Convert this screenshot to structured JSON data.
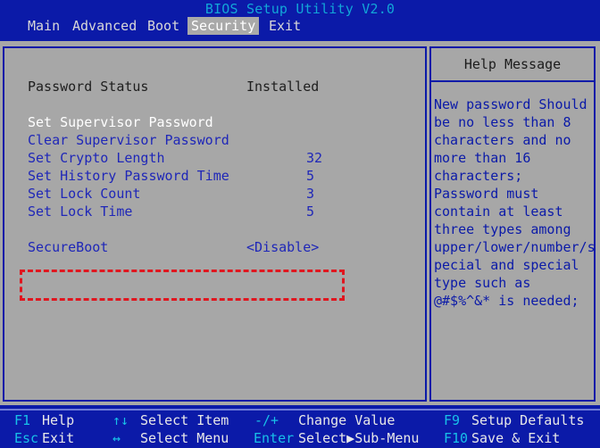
{
  "window": {
    "title": "BIOS Setup Utility V2.0"
  },
  "menu": {
    "tabs": [
      {
        "label": "Main"
      },
      {
        "label": "Advanced"
      },
      {
        "label": "Boot"
      },
      {
        "label": "Security",
        "active": true
      },
      {
        "label": "Exit"
      }
    ]
  },
  "security": {
    "password_status": {
      "label": "Password Status",
      "value": "Installed"
    },
    "set_supervisor_password": {
      "label": "Set Supervisor Password"
    },
    "clear_supervisor_password": {
      "label": "Clear Supervisor Password"
    },
    "set_crypto_length": {
      "label": "Set Crypto Length",
      "value": "32"
    },
    "set_history_password_time": {
      "label": "Set History Password Time",
      "value": "5"
    },
    "set_lock_count": {
      "label": "Set Lock Count",
      "value": "3"
    },
    "set_lock_time": {
      "label": "Set Lock Time",
      "value": "5"
    },
    "secure_boot": {
      "label": "SecureBoot",
      "value": "<Disable>"
    }
  },
  "help": {
    "title": "Help Message",
    "lines": [
      "New password Should",
      "be no less than 8",
      "characters and no",
      "more than 16",
      "characters;",
      "Password must",
      "contain at least",
      "three types among",
      "upper/lower/number/s",
      "pecial and special",
      "type such as",
      "@#$%^&* is needed;"
    ]
  },
  "footer": {
    "f1": {
      "key": "F1",
      "desc": "Help"
    },
    "esc": {
      "key": "Esc",
      "desc": "Exit"
    },
    "updown": {
      "key": "↑↓",
      "desc": "Select Item"
    },
    "leftright": {
      "key": "↔",
      "desc": "Select Menu"
    },
    "minusplus": {
      "key": "-/+",
      "desc": "Change Value"
    },
    "enter": {
      "key": "Enter",
      "desc": "Select▶Sub-Menu"
    },
    "f9": {
      "key": "F9",
      "desc": "Setup Defaults"
    },
    "f10": {
      "key": "F10",
      "desc": "Save & Exit"
    }
  },
  "colors": {
    "background": "#0b1aa8",
    "panel": "#a7a7a7",
    "item_text": "#1f27b8",
    "selected_text": "#ffffff",
    "key_text": "#18c0e8",
    "highlight_border": "#e0161f"
  }
}
